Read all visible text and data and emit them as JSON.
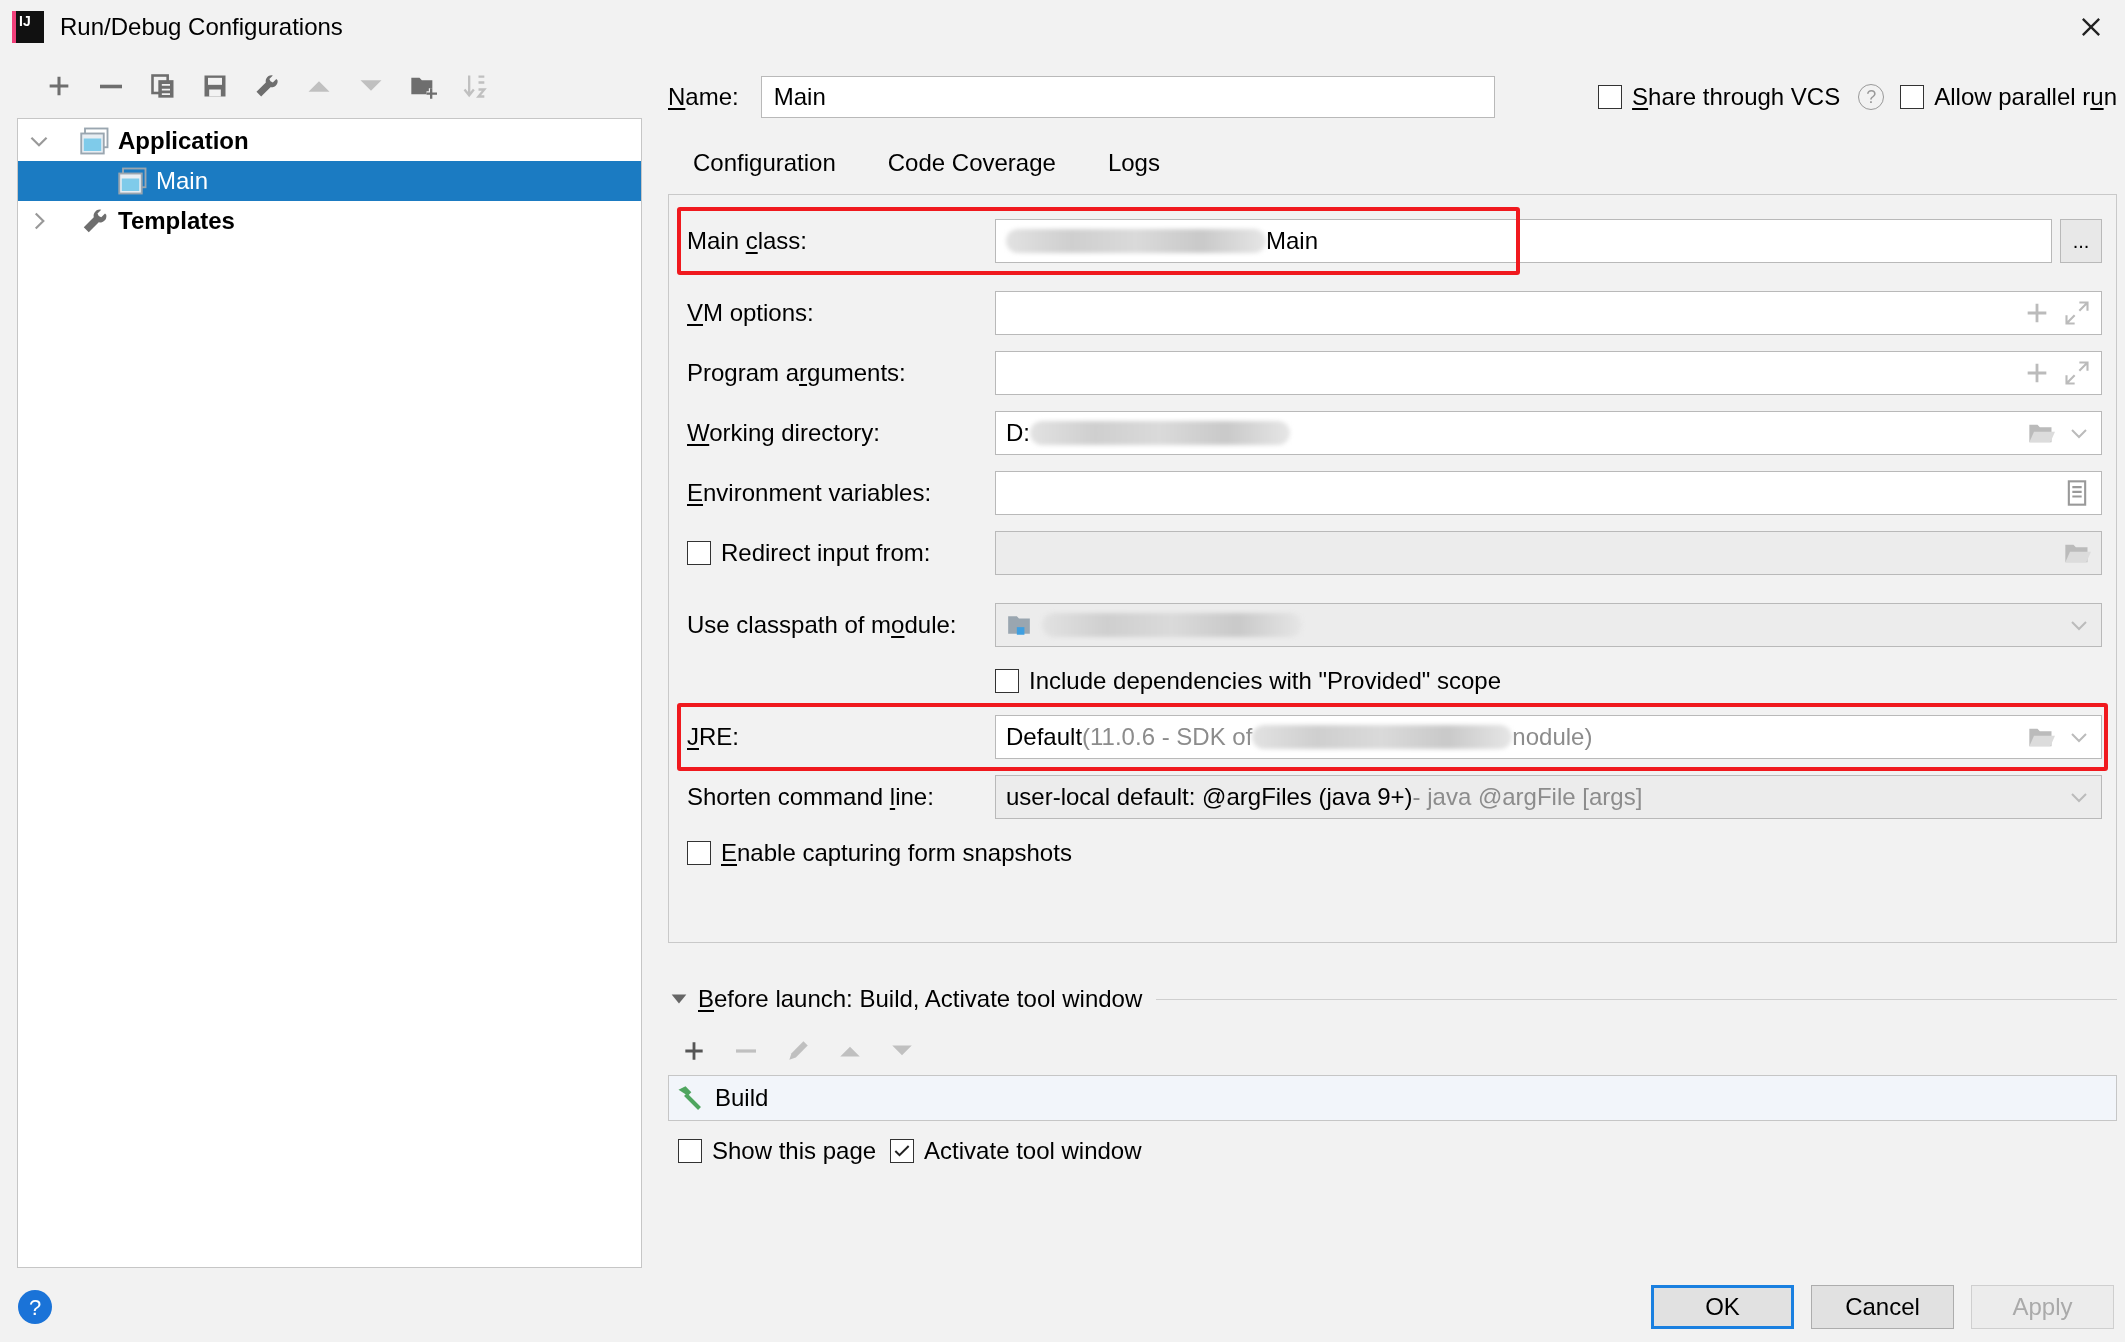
{
  "window": {
    "logo_text": "IJ",
    "title": "Run/Debug Configurations"
  },
  "toolbar": [
    {
      "disabled": false
    },
    {
      "disabled": false
    },
    {
      "disabled": false
    },
    {
      "disabled": false
    },
    {
      "disabled": false
    },
    {
      "disabled": true
    },
    {
      "disabled": true
    },
    {
      "disabled": false
    },
    {
      "disabled": true
    }
  ],
  "tree": [
    {
      "label": "Application",
      "expanded": true,
      "selected": false,
      "children": [
        {
          "label": "Main",
          "selected": true
        }
      ]
    },
    {
      "label": "Templates",
      "expanded": false,
      "selected": false
    }
  ],
  "name_field": {
    "mnemonic": "N",
    "label_after": "ame:",
    "value": "Main"
  },
  "header_options": [
    {
      "mnemonic": "S",
      "label_after": "hare through VCS",
      "checked": false,
      "help": "?"
    },
    {
      "label_before": "Allow parallel r",
      "mnemonic": "u",
      "label_after": "n",
      "checked": false
    }
  ],
  "tabs": [
    {
      "label": "Configuration"
    },
    {
      "label": "Code Coverage"
    },
    {
      "label": "Logs"
    }
  ],
  "fields": [
    {
      "kind": "text",
      "label_before": "Main ",
      "mnemonic": "c",
      "label_after": "lass:",
      "redacted": true,
      "value": "Main",
      "highlighted": true,
      "button": "..."
    },
    {
      "kind": "text",
      "mnemonic": "V",
      "label_after": "M options:"
    },
    {
      "kind": "text",
      "label_before": "Program a",
      "mnemonic": "r",
      "label_after": "guments:"
    },
    {
      "kind": "text",
      "mnemonic": "W",
      "label_after": "orking directory:",
      "value": "D:",
      "redacted": true
    },
    {
      "kind": "text",
      "mnemonic": "E",
      "label_after": "nvironment variables:"
    },
    {
      "kind": "checkbox-field",
      "label_before": "Redirect input from:",
      "checked": false,
      "disabled": true
    },
    {
      "kind": "combo",
      "label_before": "Use classpath of m",
      "mnemonic": "o",
      "label_after": "dule:",
      "redacted": true
    },
    {
      "kind": "checkbox",
      "label_before": "Include dependencies with \"Provided\" scope",
      "checked": false
    },
    {
      "kind": "text",
      "mnemonic": "J",
      "label_after": "RE:",
      "value": "Default",
      "hint": "(11.0.6 - SDK of",
      "redacted": true,
      "hint_after": "nodule)",
      "highlighted": true
    },
    {
      "kind": "combo",
      "label_before": "Shorten command ",
      "mnemonic": "l",
      "label_after": "ine:",
      "value": "user-local default: @argFiles (java 9+)",
      "hint": "- java @argFile [args]"
    },
    {
      "kind": "checkbox",
      "mnemonic": "E",
      "label_after": "nable capturing form snapshots",
      "checked": false
    }
  ],
  "before_launch": {
    "mnemonic": "B",
    "title_after": "efore launch: Build, Activate tool window",
    "expanded": true,
    "toolbar": [
      {
        "disabled": false
      },
      {
        "disabled": true
      },
      {
        "disabled": true
      },
      {
        "disabled": true
      },
      {
        "disabled": true
      }
    ],
    "tasks": [
      {
        "label": "Build"
      }
    ],
    "options": [
      {
        "label": "Show this page",
        "checked": false
      },
      {
        "label": "Activate tool window",
        "checked": true
      }
    ]
  },
  "footer": {
    "help": "?",
    "buttons": [
      {
        "label": "OK",
        "default": true,
        "disabled": false
      },
      {
        "label": "Cancel",
        "default": false,
        "disabled": false
      },
      {
        "label": "Apply",
        "default": false,
        "disabled": true
      }
    ]
  }
}
